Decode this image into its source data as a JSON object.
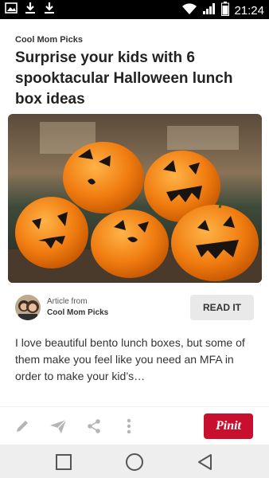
{
  "status_bar": {
    "time": "21:24",
    "left_icons": [
      "image-icon",
      "download-icon",
      "download-icon"
    ],
    "right_icons": [
      "wifi-icon",
      "signal-icon",
      "battery-icon"
    ]
  },
  "pin": {
    "source_name": "Cool Mom Picks",
    "title": "Surprise your kids with 6 spooktacular Halloween lunch box ideas",
    "image_icon": "jack-o-lantern-clementines-photo",
    "article": {
      "from_label": "Article from",
      "source": "Cool Mom Picks",
      "read_label": "READ IT"
    },
    "description": "I love beautiful bento lunch boxes, but some of them make you feel like you need an MFA in order to make your kid’s…"
  },
  "actions": {
    "icons": [
      "pencil-icon",
      "send-icon",
      "share-icon",
      "more-icon"
    ],
    "pin_it_label": "Pinit",
    "pin_it_color": "#c8102e"
  },
  "nav_bar": {
    "icons": [
      "recents-square-icon",
      "home-circle-icon",
      "back-triangle-icon"
    ]
  }
}
